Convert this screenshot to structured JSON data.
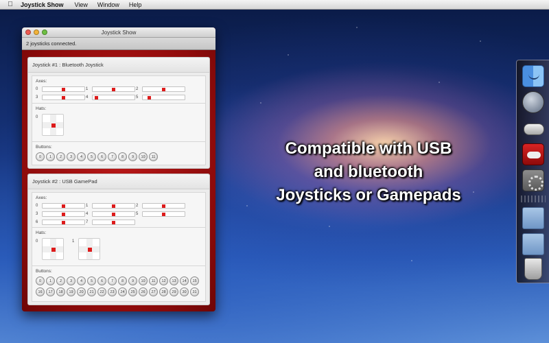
{
  "menubar": {
    "app_name": "Joystick Show",
    "items": [
      "View",
      "Window",
      "Help"
    ]
  },
  "window": {
    "title": "Joystick Show",
    "status": "2 joysticks connected."
  },
  "joysticks": [
    {
      "title": "Joystick #1 : Bluetooth Joystick",
      "axes_label": "Axes:",
      "hats_label": "Hats:",
      "buttons_label": "Buttons:",
      "axes": [
        {
          "num": "0",
          "level": 0.5
        },
        {
          "num": "1",
          "level": 0.5
        },
        {
          "num": "2",
          "level": 0.5
        },
        {
          "num": "3",
          "level": 0.5
        },
        {
          "num": "4",
          "level": 0.05
        },
        {
          "num": "5",
          "level": 0.12
        }
      ],
      "hats": [
        {
          "num": "0"
        }
      ],
      "buttons": [
        "0",
        "1",
        "2",
        "3",
        "4",
        "5",
        "6",
        "7",
        "8",
        "9",
        "10",
        "11"
      ]
    },
    {
      "title": "Joystick #2 : USB GamePad",
      "axes_label": "Axes:",
      "hats_label": "Hats:",
      "buttons_label": "Buttons:",
      "axes": [
        {
          "num": "0",
          "level": 0.5
        },
        {
          "num": "1",
          "level": 0.5
        },
        {
          "num": "2",
          "level": 0.5
        },
        {
          "num": "3",
          "level": 0.5
        },
        {
          "num": "4",
          "level": 0.5
        },
        {
          "num": "5",
          "level": 0.5
        },
        {
          "num": "6",
          "level": 0.5
        },
        {
          "num": "7",
          "level": 0.5
        }
      ],
      "hats": [
        {
          "num": "0"
        },
        {
          "num": "1"
        }
      ],
      "buttons": [
        "0",
        "1",
        "2",
        "3",
        "4",
        "5",
        "6",
        "7",
        "8",
        "9",
        "10",
        "11",
        "12",
        "13",
        "14",
        "15",
        "16",
        "17",
        "18",
        "19",
        "20",
        "21",
        "22",
        "23",
        "24",
        "25",
        "26",
        "27",
        "28",
        "29",
        "30",
        "31"
      ]
    }
  ],
  "promo": {
    "line1": "Compatible with USB",
    "line2": "and bluetooth",
    "line3": "Joysticks or Gamepads"
  },
  "dock": {
    "icons": [
      "finder-icon",
      "launchpad-icon",
      "gamepad-icon",
      "joystick-show-icon",
      "system-preferences-icon",
      "documents-folder-icon",
      "applications-folder-icon",
      "trash-icon"
    ]
  },
  "colors": {
    "accent_red": "#dd1b1b",
    "window_bg_red": "#9d0f0f"
  }
}
